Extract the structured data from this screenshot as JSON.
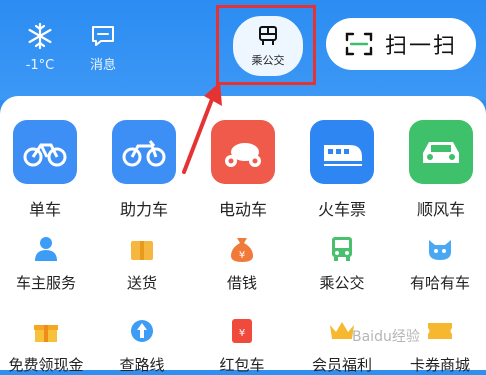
{
  "top": {
    "weather_temp": "-1°C",
    "message_label": "消息",
    "bus_label": "乘公交",
    "scan_label": "扫一扫"
  },
  "services_main": [
    {
      "label": "单车",
      "icon": "bicycle-icon",
      "color": "#3d8ff5"
    },
    {
      "label": "助力车",
      "icon": "ebike-icon",
      "color": "#3d8ff5"
    },
    {
      "label": "电动车",
      "icon": "scooter-icon",
      "color": "#f05a4a"
    },
    {
      "label": "火车票",
      "icon": "train-icon",
      "color": "#2e86f3"
    },
    {
      "label": "顺风车",
      "icon": "car-icon",
      "color": "#3fc06a"
    }
  ],
  "services_row2": [
    {
      "label": "车主服务",
      "icon": "driver-icon"
    },
    {
      "label": "送货",
      "icon": "package-icon"
    },
    {
      "label": "借钱",
      "icon": "money-bag-icon"
    },
    {
      "label": "乘公交",
      "icon": "bus-icon"
    },
    {
      "label": "有哈有车",
      "icon": "cat-icon"
    }
  ],
  "services_row3": [
    {
      "label": "免费领现金",
      "icon": "gift-icon"
    },
    {
      "label": "查路线",
      "icon": "route-icon"
    },
    {
      "label": "红包车",
      "icon": "red-envelope-icon"
    },
    {
      "label": "会员福利",
      "icon": "crown-icon"
    },
    {
      "label": "卡券商城",
      "icon": "coupon-icon"
    }
  ],
  "colors": {
    "accent_blue": "#2f8ef0",
    "highlight_red": "#e53333"
  },
  "watermark_text": "Baidu经验"
}
